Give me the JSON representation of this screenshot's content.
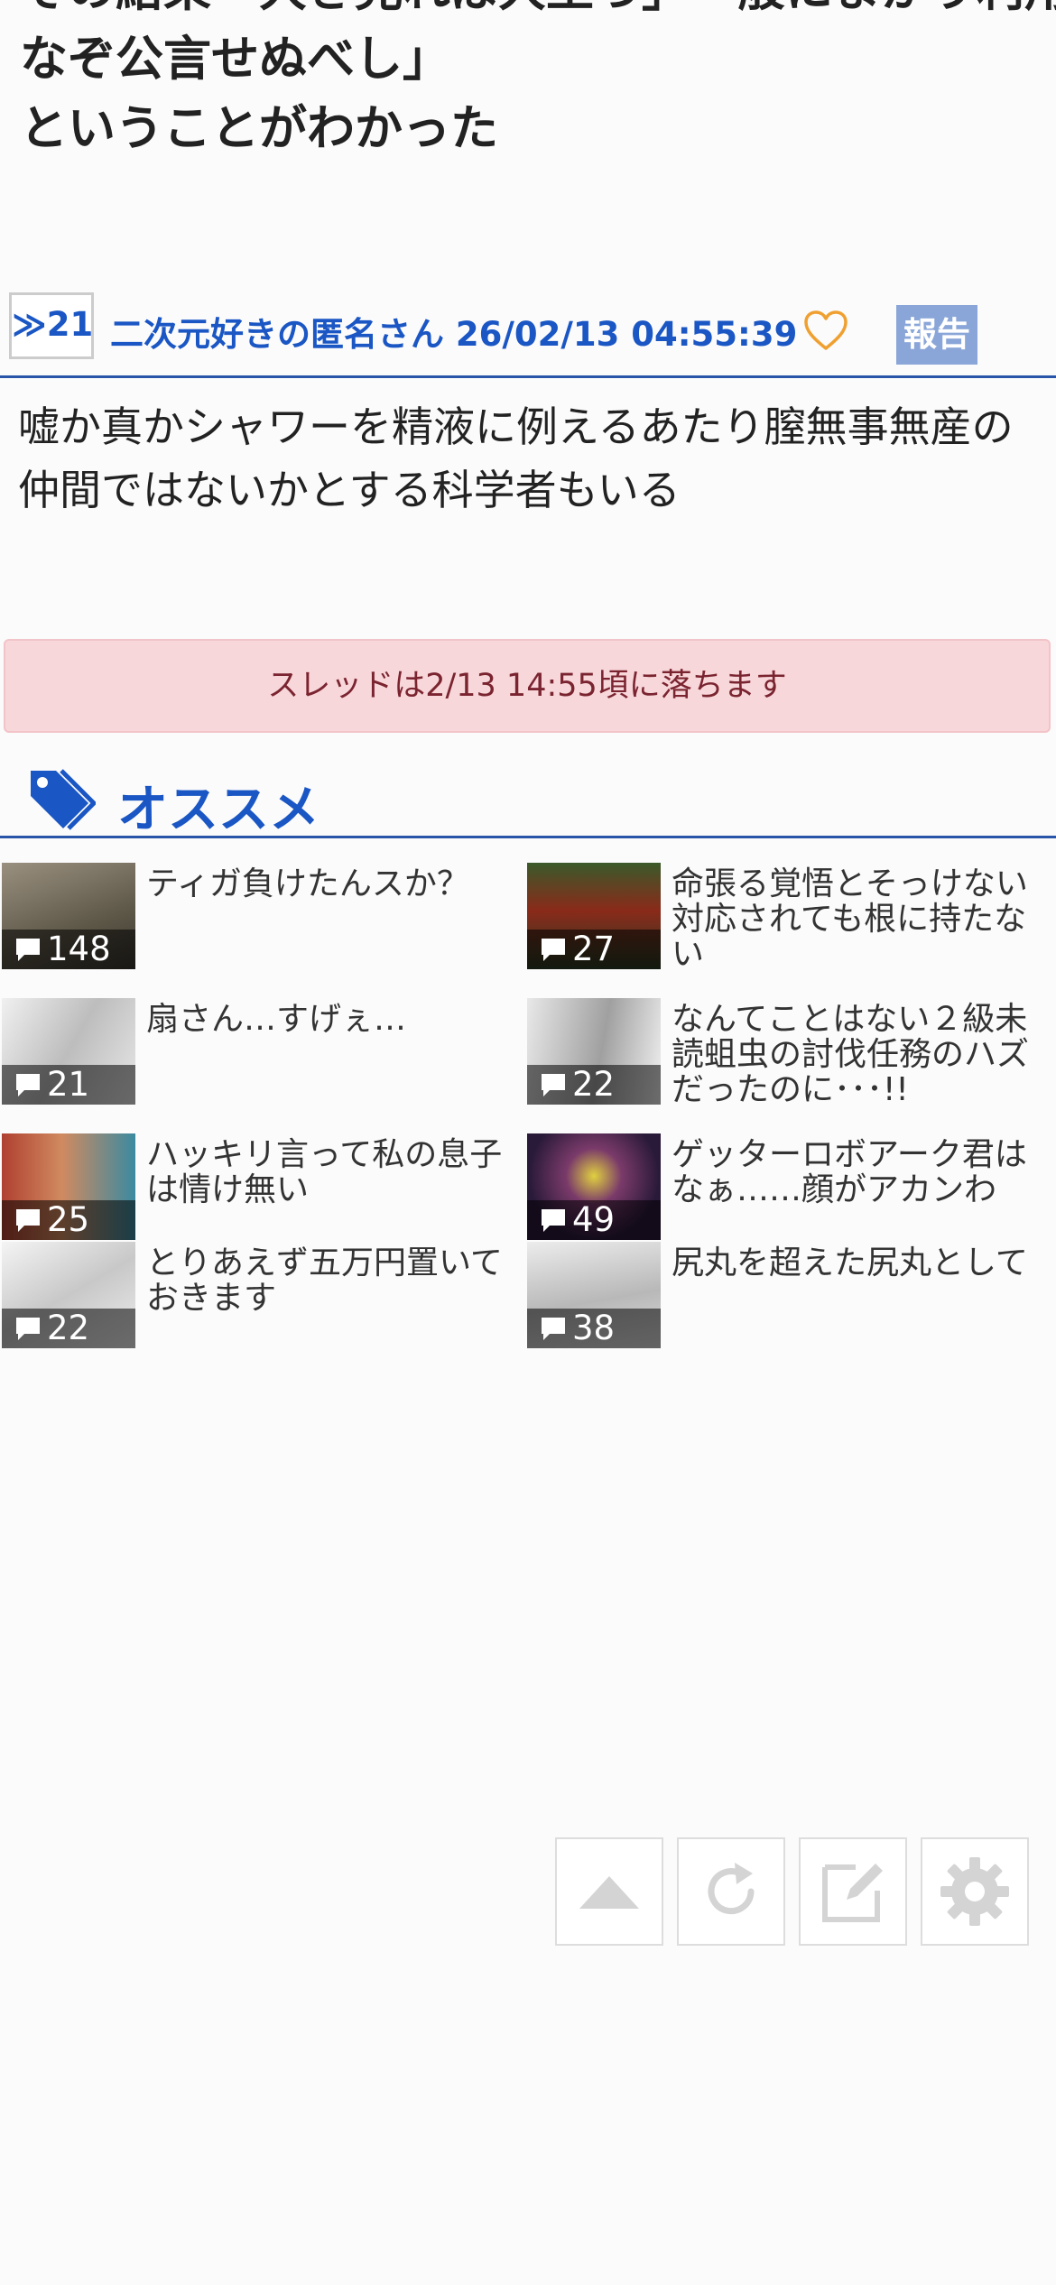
{
  "previous_post": {
    "body_lines": [
      "その結果「大き見れば大王っ」一般にまかり利用",
      "なぞ公言せぬべし」",
      "ということがわかった"
    ]
  },
  "post": {
    "res_number": "≫21",
    "poster_line": "二次元好きの匿名さん 26/02/13 04:55:39",
    "report_label": "報告",
    "body": "嘘か真かシャワーを精液に例えるあたり膣無事無産の仲間ではないかとする科学者もいる",
    "colors": {
      "accent": "#1a56c4",
      "heart": "#f0a030",
      "report_bg": "#8aa6d8"
    }
  },
  "notice": {
    "text": "スレッドは2/13 14:55頃に落ちます"
  },
  "recommend": {
    "title": "オススメ",
    "items": [
      {
        "title": "ティガ負けたんスか？",
        "count": "148",
        "thumb_color": "#7a7060"
      },
      {
        "title": "命張る覚悟とそっけない対応されても根に持たない",
        "count": "27",
        "thumb_color": "#4a5a3a"
      },
      {
        "title": "扇さん…すげぇ…",
        "count": "21",
        "thumb_color": "#d8d8d8"
      },
      {
        "title": "なんてことはない２級未読蛆虫の討伐任務のハズだったのに･･･!!",
        "count": "22",
        "thumb_color": "#cfcfcf"
      },
      {
        "title": "ハッキリ言って私の息子は情け無い",
        "count": "25",
        "thumb_color": "#a04030"
      },
      {
        "title": "ゲッターロボアーク君はなぁ……顔がアカンわ",
        "count": "49",
        "thumb_color": "#3a2a4a"
      },
      {
        "title": "とりあえず五万円置いておきます",
        "count": "22",
        "thumb_color": "#e0e0e0"
      },
      {
        "title": "尻丸を超えた尻丸として",
        "count": "38",
        "thumb_color": "#d0d0d0"
      }
    ]
  },
  "toolbar": {
    "icons": [
      "up-arrow-icon",
      "reload-icon",
      "edit-icon",
      "gear-icon"
    ]
  }
}
